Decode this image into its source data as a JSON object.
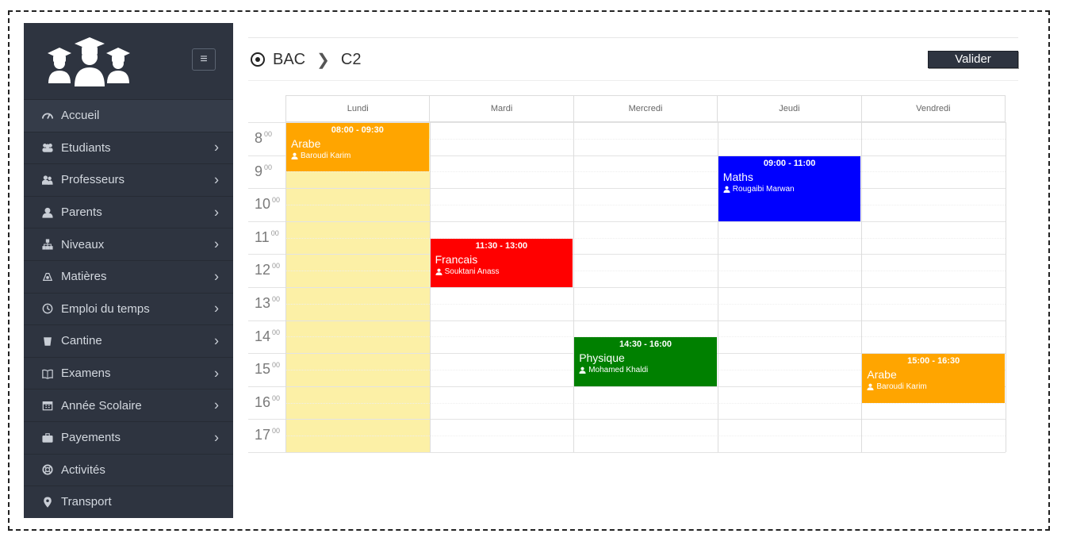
{
  "sidebar": {
    "items": [
      {
        "label": "Accueil",
        "icon": "dashboard-icon",
        "has_children": false
      },
      {
        "label": "Etudiants",
        "icon": "students-icon",
        "has_children": true
      },
      {
        "label": "Professeurs",
        "icon": "teachers-icon",
        "has_children": true
      },
      {
        "label": "Parents",
        "icon": "user-icon",
        "has_children": true
      },
      {
        "label": "Niveaux",
        "icon": "sitemap-icon",
        "has_children": true
      },
      {
        "label": "Matières",
        "icon": "subjects-icon",
        "has_children": true
      },
      {
        "label": "Emploi du temps",
        "icon": "clock-icon",
        "has_children": true
      },
      {
        "label": "Cantine",
        "icon": "cup-icon",
        "has_children": true
      },
      {
        "label": "Examens",
        "icon": "book-icon",
        "has_children": true
      },
      {
        "label": "Année Scolaire",
        "icon": "calendar-icon",
        "has_children": true
      },
      {
        "label": "Payements",
        "icon": "briefcase-icon",
        "has_children": true
      },
      {
        "label": "Activités",
        "icon": "lifebuoy-icon",
        "has_children": false
      },
      {
        "label": "Transport",
        "icon": "map-marker-icon",
        "has_children": false
      }
    ],
    "hamburger_icon": "hamburger-icon",
    "logo_icon": "graduates-logo-icon"
  },
  "breadcrumb": {
    "root": "BAC",
    "current": "C2"
  },
  "header": {
    "validate_label": "Valider"
  },
  "calendar": {
    "days": [
      "Lundi",
      "Mardi",
      "Mercredi",
      "Jeudi",
      "Vendredi"
    ],
    "hours": [
      "8",
      "9",
      "10",
      "11",
      "12",
      "13",
      "14",
      "15",
      "16",
      "17"
    ],
    "minutes_label": "00",
    "today_day": "Lundi",
    "events": [
      {
        "day": "Lundi",
        "time": "08:00 - 09:30",
        "subject": "Arabe",
        "teacher": "Baroudi Karim",
        "color": "#FFA500",
        "start": 8.0,
        "end": 9.5
      },
      {
        "day": "Mardi",
        "time": "11:30 - 13:00",
        "subject": "Francais",
        "teacher": "Souktani Anass",
        "color": "#FF0000",
        "start": 11.5,
        "end": 13.0
      },
      {
        "day": "Mercredi",
        "time": "14:30 - 16:00",
        "subject": "Physique",
        "teacher": "Mohamed Khaldi",
        "color": "#008000",
        "start": 14.5,
        "end": 16.0
      },
      {
        "day": "Jeudi",
        "time": "09:00 - 11:00",
        "subject": "Maths",
        "teacher": "Rougaibi Marwan",
        "color": "#0000FF",
        "start": 9.0,
        "end": 11.0
      },
      {
        "day": "Vendredi",
        "time": "15:00 - 16:30",
        "subject": "Arabe",
        "teacher": "Baroudi Karim",
        "color": "#FFA500",
        "start": 15.0,
        "end": 16.5
      }
    ]
  },
  "colors": {
    "sidebar_bg": "#2e3440",
    "today_bg": "#fcf0a6",
    "button_bg": "#2e3440"
  }
}
